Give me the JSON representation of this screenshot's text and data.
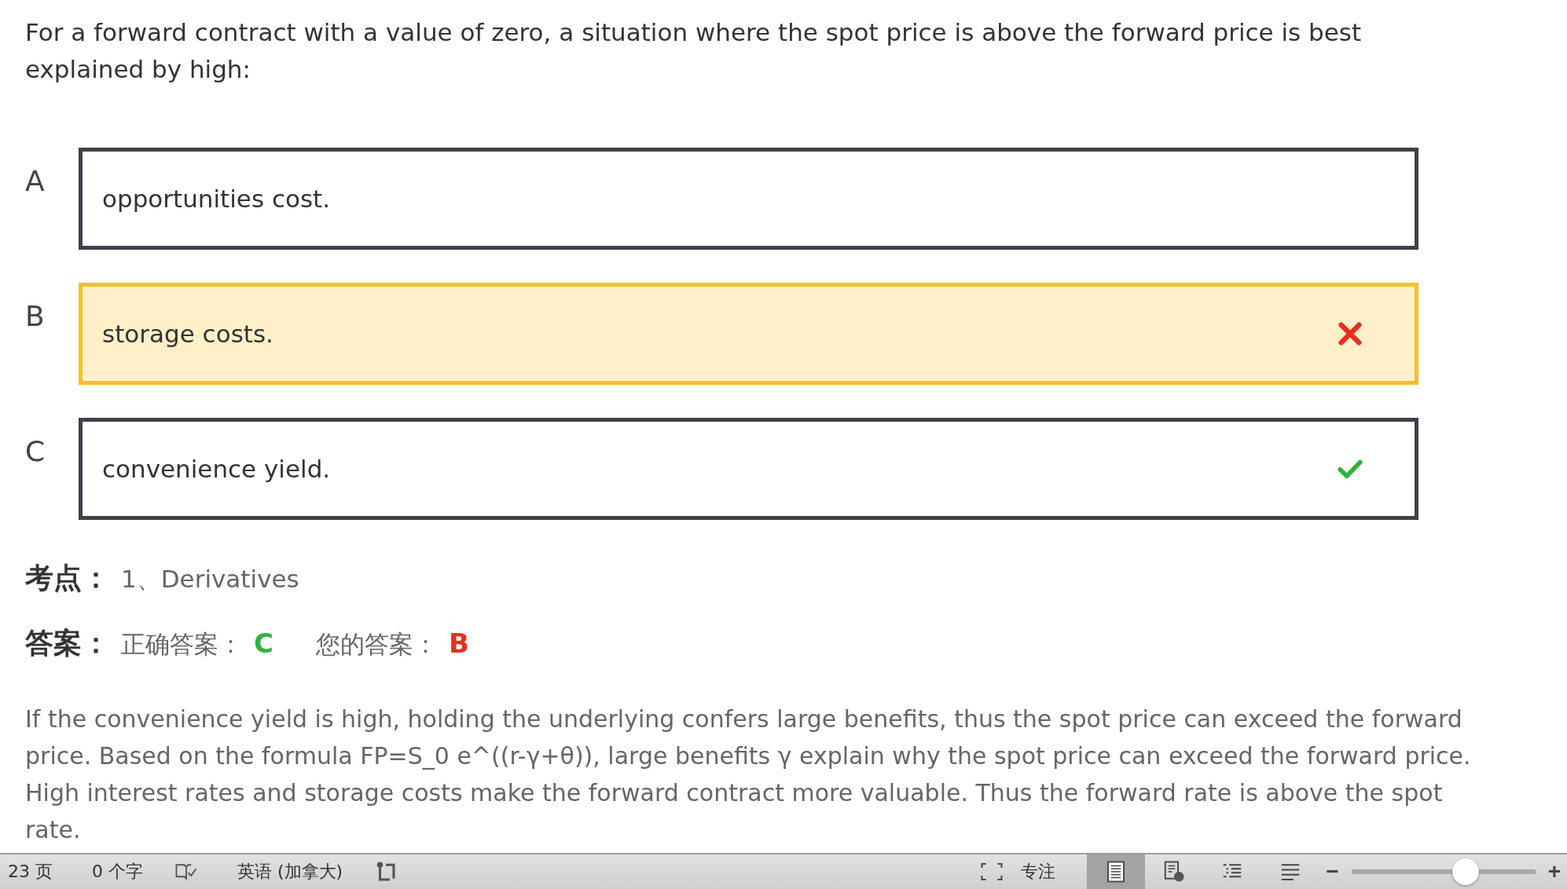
{
  "question": "For a forward contract with a value of zero, a situation where the spot price is above the forward price is best explained by high:",
  "options": [
    {
      "letter": "A",
      "text": "opportunities cost.",
      "selected": false,
      "correct": false
    },
    {
      "letter": "B",
      "text": "storage costs.",
      "selected": true,
      "correct": false
    },
    {
      "letter": "C",
      "text": "convenience yield.",
      "selected": false,
      "correct": true
    }
  ],
  "topic": {
    "label": "考点：",
    "value": "1、Derivatives"
  },
  "answer": {
    "label": "答案：",
    "correct_label": "正确答案：",
    "correct_value": "C",
    "yours_label": "您的答案：",
    "yours_value": "B"
  },
  "explanation": "If the convenience yield is high, holding the underlying confers large benefits, thus the spot price can exceed the forward price. Based on the formula FP=S_0 e^((r-γ+θ)), large benefits γ explain why the spot price can exceed the forward price. High interest rates and storage costs make the forward contract more valuable. Thus the forward rate is above the spot rate.",
  "status_bar": {
    "page": "23 页",
    "words": "0 个字",
    "language": "英语 (加拿大)",
    "focus": "专注",
    "views": [
      {
        "kind": "print",
        "selected": true
      },
      {
        "kind": "web",
        "selected": false
      },
      {
        "kind": "outline",
        "selected": false
      },
      {
        "kind": "draft",
        "selected": false
      }
    ],
    "zoom": {
      "level": 0.64,
      "minus": "−",
      "plus": "+"
    }
  }
}
